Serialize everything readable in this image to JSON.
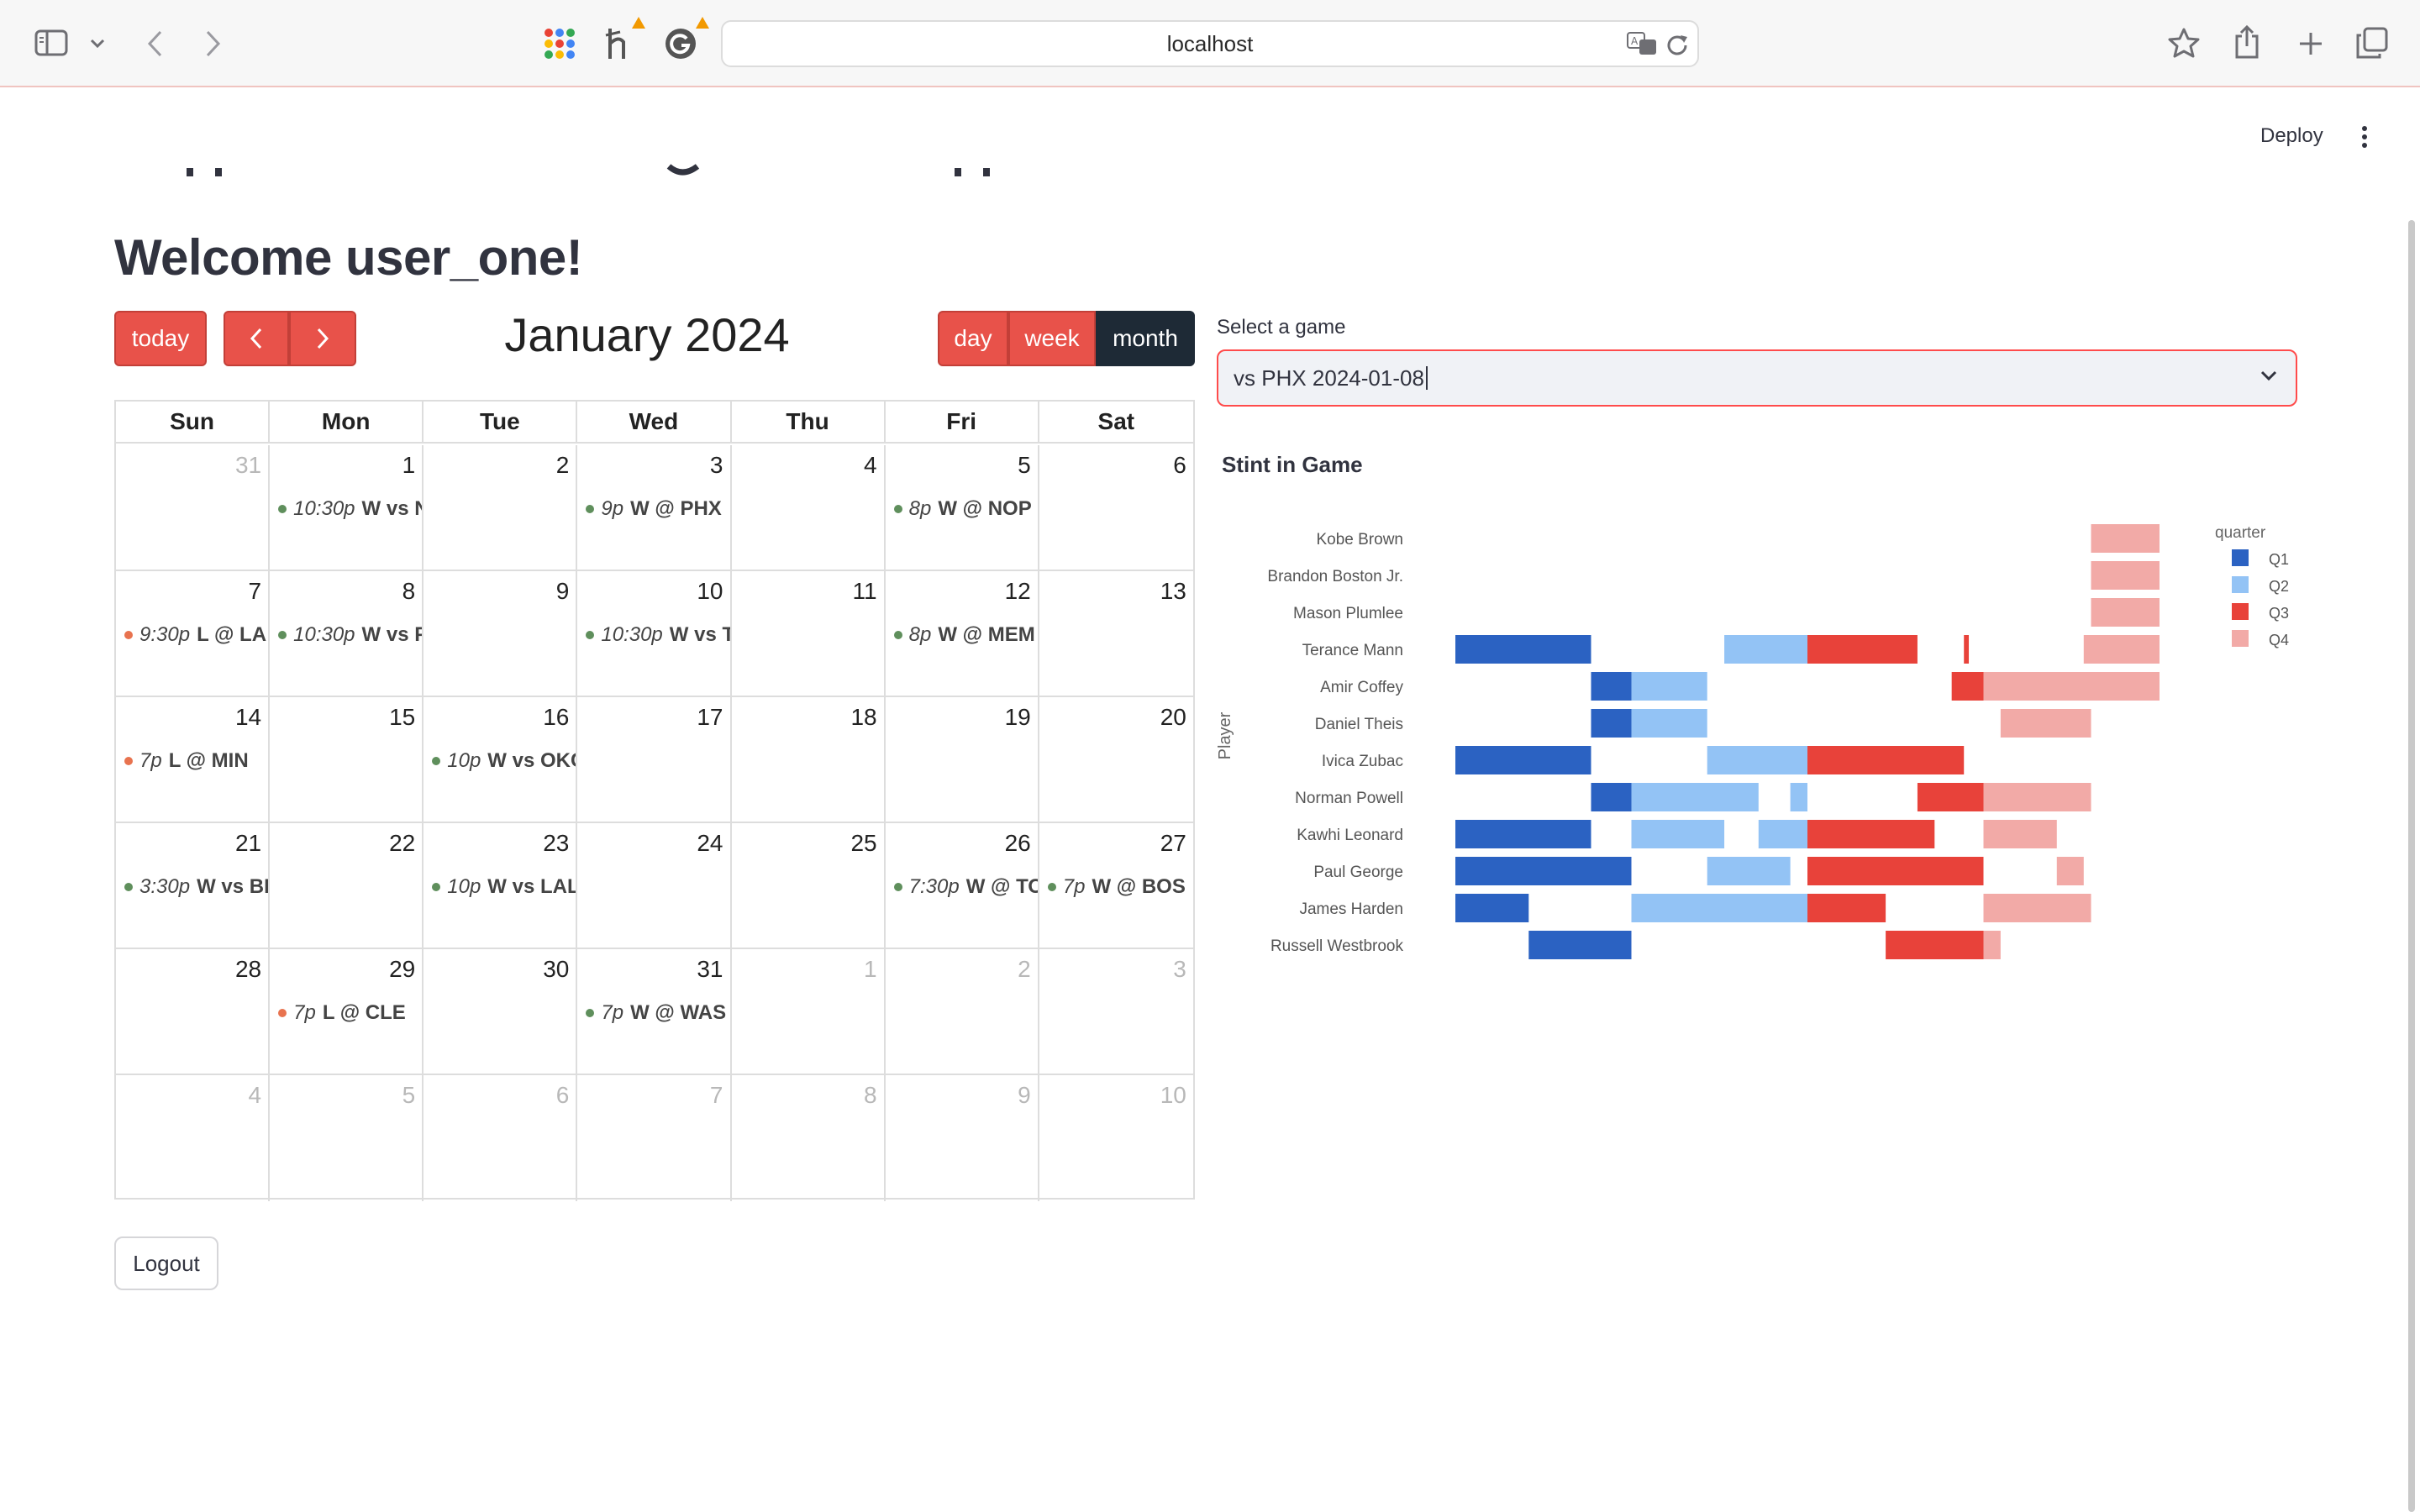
{
  "browser": {
    "url": "localhost"
  },
  "app": {
    "deploy_label": "Deploy",
    "welcome": "Welcome user_one!",
    "logout_label": "Logout"
  },
  "calendar": {
    "today_label": "today",
    "title": "January 2024",
    "views": [
      "day",
      "week",
      "month"
    ],
    "active_view": "month",
    "weekdays": [
      "Sun",
      "Mon",
      "Tue",
      "Wed",
      "Thu",
      "Fri",
      "Sat"
    ],
    "weeks": [
      [
        {
          "day": "31",
          "other": true
        },
        {
          "day": "1",
          "event": {
            "time": "10:30p",
            "text": "W vs N",
            "status": "win"
          }
        },
        {
          "day": "2"
        },
        {
          "day": "3",
          "event": {
            "time": "9p",
            "text": "W @ PHX",
            "status": "win"
          }
        },
        {
          "day": "4"
        },
        {
          "day": "5",
          "event": {
            "time": "8p",
            "text": "W @ NOP",
            "status": "win"
          }
        },
        {
          "day": "6"
        }
      ],
      [
        {
          "day": "7",
          "event": {
            "time": "9:30p",
            "text": "L @ LA",
            "status": "loss"
          }
        },
        {
          "day": "8",
          "event": {
            "time": "10:30p",
            "text": "W vs P",
            "status": "win"
          }
        },
        {
          "day": "9"
        },
        {
          "day": "10",
          "event": {
            "time": "10:30p",
            "text": "W vs T",
            "status": "win"
          }
        },
        {
          "day": "11"
        },
        {
          "day": "12",
          "event": {
            "time": "8p",
            "text": "W @ MEM",
            "status": "win"
          }
        },
        {
          "day": "13"
        }
      ],
      [
        {
          "day": "14",
          "event": {
            "time": "7p",
            "text": "L @ MIN",
            "status": "loss"
          }
        },
        {
          "day": "15"
        },
        {
          "day": "16",
          "event": {
            "time": "10p",
            "text": "W vs OKC",
            "status": "win"
          }
        },
        {
          "day": "17"
        },
        {
          "day": "18"
        },
        {
          "day": "19"
        },
        {
          "day": "20"
        }
      ],
      [
        {
          "day": "21",
          "event": {
            "time": "3:30p",
            "text": "W vs BK",
            "status": "win"
          }
        },
        {
          "day": "22"
        },
        {
          "day": "23",
          "event": {
            "time": "10p",
            "text": "W vs LAL",
            "status": "win"
          }
        },
        {
          "day": "24"
        },
        {
          "day": "25"
        },
        {
          "day": "26",
          "event": {
            "time": "7:30p",
            "text": "W @ TOR",
            "status": "win"
          }
        },
        {
          "day": "27",
          "event": {
            "time": "7p",
            "text": "W @ BOS",
            "status": "win"
          }
        }
      ],
      [
        {
          "day": "28"
        },
        {
          "day": "29",
          "event": {
            "time": "7p",
            "text": "L @ CLE",
            "status": "loss"
          }
        },
        {
          "day": "30"
        },
        {
          "day": "31",
          "event": {
            "time": "7p",
            "text": "W @ WAS",
            "status": "win"
          }
        },
        {
          "day": "1",
          "other": true
        },
        {
          "day": "2",
          "other": true
        },
        {
          "day": "3",
          "other": true
        }
      ],
      [
        {
          "day": "4",
          "other": true
        },
        {
          "day": "5",
          "other": true
        },
        {
          "day": "6",
          "other": true
        },
        {
          "day": "7",
          "other": true
        },
        {
          "day": "8",
          "other": true
        },
        {
          "day": "9",
          "other": true
        },
        {
          "day": "10",
          "other": true
        }
      ]
    ],
    "colors": {
      "win": "#5f8f5c",
      "loss": "#e8734f",
      "button": "#e8524a",
      "active": "#1e2a36"
    }
  },
  "game_select": {
    "label": "Select a game",
    "value": "vs PHX 2024-01-08"
  },
  "chart_data": {
    "type": "bar",
    "subtype": "horizontal timeline (stint intervals)",
    "title": "Stint in Game",
    "ylabel": "Player",
    "legend_title": "quarter",
    "legend_position": "right",
    "x_unit": "game seconds elapsed (estimated, axis not shown)",
    "xlim": [
      0,
      2880
    ],
    "players": [
      "Kobe Brown",
      "Brandon Boston Jr.",
      "Mason Plumlee",
      "Terance Mann",
      "Amir Coffey",
      "Daniel Theis",
      "Ivica Zubac",
      "Norman Powell",
      "Kawhi Leonard",
      "Paul George",
      "James Harden",
      "Russell Westbrook"
    ],
    "series": [
      {
        "name": "Q1",
        "color": "#2b62c2",
        "stints": [
          {
            "player": "Terance Mann",
            "start": 0,
            "end": 555
          },
          {
            "player": "Amir Coffey",
            "start": 555,
            "end": 720
          },
          {
            "player": "Daniel Theis",
            "start": 555,
            "end": 720
          },
          {
            "player": "Ivica Zubac",
            "start": 0,
            "end": 555
          },
          {
            "player": "Norman Powell",
            "start": 555,
            "end": 720
          },
          {
            "player": "Kawhi Leonard",
            "start": 0,
            "end": 555
          },
          {
            "player": "Paul George",
            "start": 0,
            "end": 720
          },
          {
            "player": "James Harden",
            "start": 0,
            "end": 300
          },
          {
            "player": "Russell Westbrook",
            "start": 300,
            "end": 720
          }
        ]
      },
      {
        "name": "Q2",
        "color": "#93c3f5",
        "stints": [
          {
            "player": "Terance Mann",
            "start": 1100,
            "end": 1440
          },
          {
            "player": "Amir Coffey",
            "start": 720,
            "end": 1030
          },
          {
            "player": "Daniel Theis",
            "start": 720,
            "end": 1030
          },
          {
            "player": "Ivica Zubac",
            "start": 1030,
            "end": 1440
          },
          {
            "player": "Norman Powell",
            "start": 720,
            "end": 1240
          },
          {
            "player": "Norman Powell",
            "start": 1370,
            "end": 1440
          },
          {
            "player": "Kawhi Leonard",
            "start": 720,
            "end": 1100
          },
          {
            "player": "Kawhi Leonard",
            "start": 1240,
            "end": 1440
          },
          {
            "player": "Paul George",
            "start": 1030,
            "end": 1370
          },
          {
            "player": "James Harden",
            "start": 720,
            "end": 1440
          }
        ]
      },
      {
        "name": "Q3",
        "color": "#e8423a",
        "stints": [
          {
            "player": "Terance Mann",
            "start": 1440,
            "end": 1890
          },
          {
            "player": "Terance Mann",
            "start": 2080,
            "end": 2100
          },
          {
            "player": "Amir Coffey",
            "start": 2030,
            "end": 2160
          },
          {
            "player": "Ivica Zubac",
            "start": 1440,
            "end": 2080
          },
          {
            "player": "Norman Powell",
            "start": 1890,
            "end": 2160
          },
          {
            "player": "Kawhi Leonard",
            "start": 1440,
            "end": 1960
          },
          {
            "player": "Paul George",
            "start": 1440,
            "end": 2160
          },
          {
            "player": "James Harden",
            "start": 1440,
            "end": 1760
          },
          {
            "player": "Russell Westbrook",
            "start": 1760,
            "end": 2160
          }
        ]
      },
      {
        "name": "Q4",
        "color": "#f2aaa7",
        "stints": [
          {
            "player": "Kobe Brown",
            "start": 2600,
            "end": 2880
          },
          {
            "player": "Brandon Boston Jr.",
            "start": 2600,
            "end": 2880
          },
          {
            "player": "Mason Plumlee",
            "start": 2600,
            "end": 2880
          },
          {
            "player": "Terance Mann",
            "start": 2570,
            "end": 2880
          },
          {
            "player": "Amir Coffey",
            "start": 2160,
            "end": 2880
          },
          {
            "player": "Daniel Theis",
            "start": 2230,
            "end": 2600
          },
          {
            "player": "Norman Powell",
            "start": 2160,
            "end": 2600
          },
          {
            "player": "Kawhi Leonard",
            "start": 2160,
            "end": 2460
          },
          {
            "player": "Paul George",
            "start": 2460,
            "end": 2570
          },
          {
            "player": "James Harden",
            "start": 2160,
            "end": 2600
          },
          {
            "player": "Russell Westbrook",
            "start": 2160,
            "end": 2230
          }
        ]
      }
    ]
  }
}
